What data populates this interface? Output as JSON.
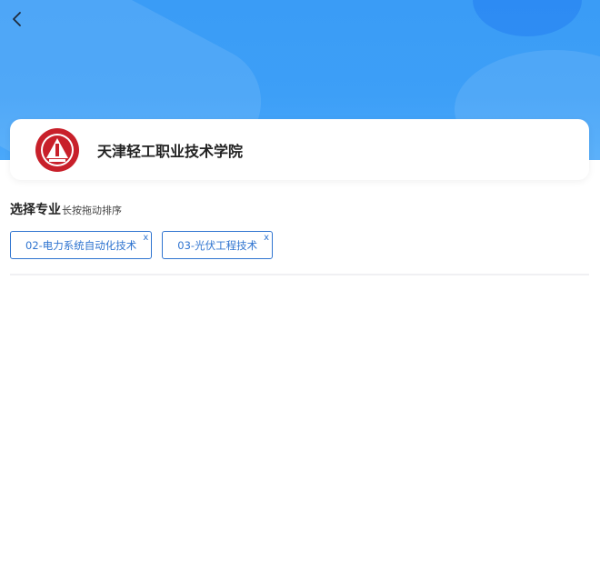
{
  "school": {
    "name": "天津轻工职业技术学院"
  },
  "section": {
    "title": "选择专业",
    "hint": "长按拖动排序"
  },
  "majors": [
    {
      "label": "02-电力系统自动化技术",
      "remove": "x"
    },
    {
      "label": "03-光伏工程技术",
      "remove": "x"
    }
  ],
  "icons": {
    "back": "back-arrow-icon",
    "logo": "school-logo-icon"
  },
  "colors": {
    "header": "#3d9ff7",
    "accent": "#2f74d0",
    "logo": "#c8202a"
  }
}
